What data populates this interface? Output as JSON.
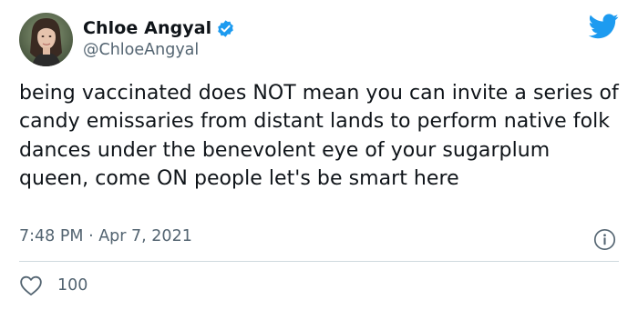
{
  "author": {
    "display_name": "Chloe Angyal",
    "handle": "@ChloeAngyal",
    "verified": true,
    "avatar_icon": "profile-photo"
  },
  "tweet": {
    "text": "being vaccinated does NOT mean you can invite a series of candy emissaries from distant lands to perform native folk dances under the benevolent eye of your sugarplum queen, come ON people let's be smart here",
    "timestamp": "7:48 PM · Apr 7, 2021"
  },
  "actions": {
    "like_icon": "heart-icon",
    "like_count": "100"
  },
  "icons": {
    "brand": "twitter-bird-icon",
    "info": "info-icon",
    "verified": "verified-badge-icon"
  },
  "colors": {
    "brand_blue": "#1d9bf0",
    "text_primary": "#0f1419",
    "text_secondary": "#536471",
    "divider": "#cfd9de"
  }
}
